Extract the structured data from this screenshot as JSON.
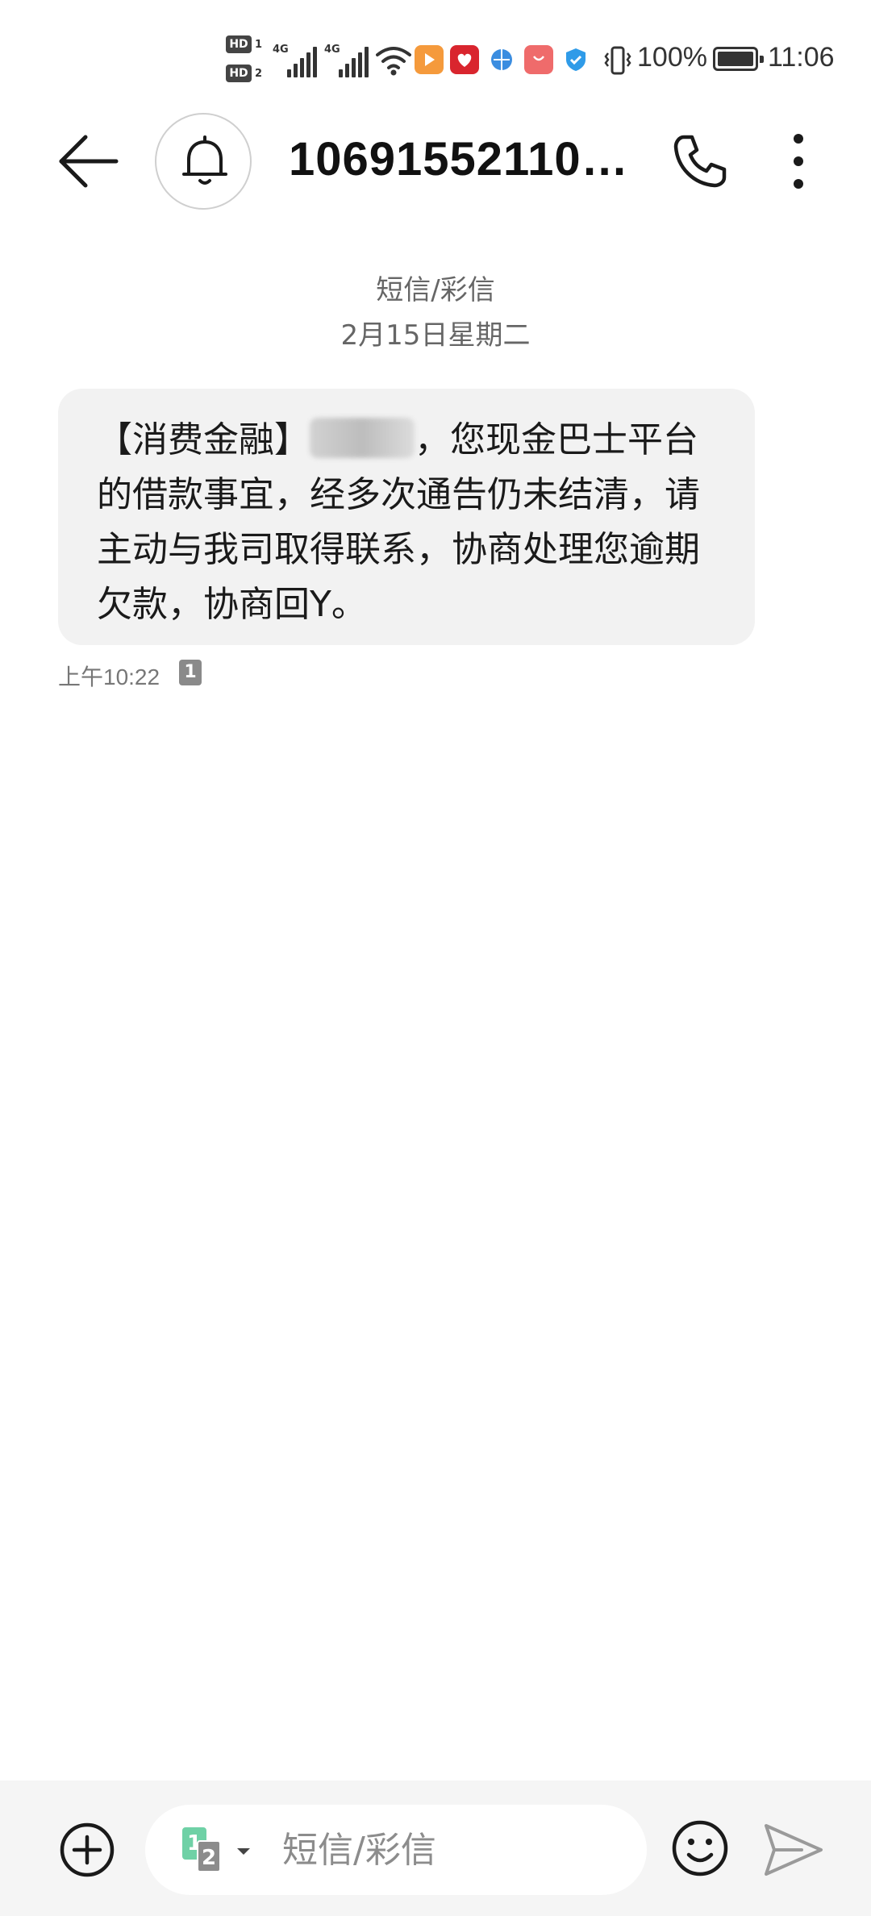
{
  "status_bar": {
    "hd1": "HD",
    "hd1_sub": "1",
    "hd2": "HD",
    "hd2_sub": "2",
    "network1": "4G",
    "network2": "4G",
    "battery_percent": "100%",
    "time": "11:06",
    "icons": [
      "signal-icon",
      "signal-icon",
      "wifi-icon",
      "video-app-icon",
      "heart-app-icon",
      "globe-app-icon",
      "bag-app-icon",
      "shield-app-icon",
      "vibrate-icon",
      "battery-icon"
    ]
  },
  "header": {
    "contact_name": "10691552110…",
    "icons": [
      "back-arrow-icon",
      "bell-icon",
      "phone-icon",
      "more-vertical-icon"
    ]
  },
  "conversation": {
    "message_type": "短信/彩信",
    "date": "2月15日星期二",
    "messages": [
      {
        "text_prefix": "【消费金融】",
        "text_body": "，您现金巴士平台的借款事宜，经多次通告仍未结清，请主动与我司取得联系，协商处理您逾期欠款，协商回Y。",
        "time": "上午10:22",
        "sim": "1"
      }
    ]
  },
  "input_bar": {
    "placeholder": "短信/彩信",
    "sim_primary": "1",
    "sim_secondary": "2",
    "icons": [
      "plus-circle-icon",
      "chevron-down-icon",
      "emoji-icon",
      "send-icon"
    ]
  },
  "colors": {
    "bubble_bg": "#f2f2f2",
    "input_bar_bg": "#f5f5f5",
    "sim1": "#6fd1a6",
    "sim2": "#8c8c8c"
  }
}
